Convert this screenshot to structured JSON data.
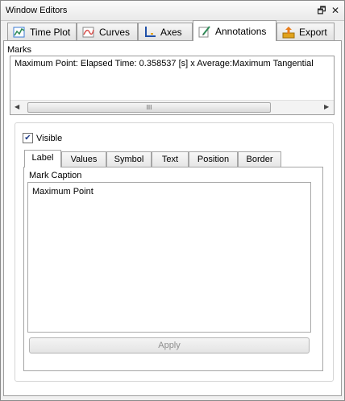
{
  "window": {
    "title": "Window Editors",
    "restore_glyph": "🗗",
    "close_glyph": "✕"
  },
  "tabs": [
    {
      "label": "Time Plot",
      "icon": "time-plot-icon"
    },
    {
      "label": "Curves",
      "icon": "curves-icon"
    },
    {
      "label": "Axes",
      "icon": "axes-icon"
    },
    {
      "label": "Annotations",
      "icon": "annotations-icon",
      "active": true
    },
    {
      "label": "Export",
      "icon": "export-icon"
    }
  ],
  "marks": {
    "label": "Marks",
    "items": [
      "Maximum Point: Elapsed Time: 0.358537 [s] x Average:Maximum Tangential"
    ],
    "scroll_left": "◀",
    "scroll_right": "▶",
    "thumb_grip": "III"
  },
  "visible": {
    "label": "Visible",
    "checked": true,
    "check_glyph": "✔"
  },
  "subtabs": [
    {
      "label": "Label",
      "active": true
    },
    {
      "label": "Values"
    },
    {
      "label": "Symbol"
    },
    {
      "label": "Text"
    },
    {
      "label": "Position"
    },
    {
      "label": "Border"
    }
  ],
  "label_tab": {
    "caption_label": "Mark Caption",
    "caption_value": "Maximum Point",
    "apply_label": "Apply"
  },
  "colors": {
    "time_plot_icon": "#3a7bd5",
    "curves_icon": "#d9534f",
    "axes_icon": "#1f4fa8",
    "annotations_icon": "#2e8b57",
    "export_icon": "#e0a21c"
  }
}
